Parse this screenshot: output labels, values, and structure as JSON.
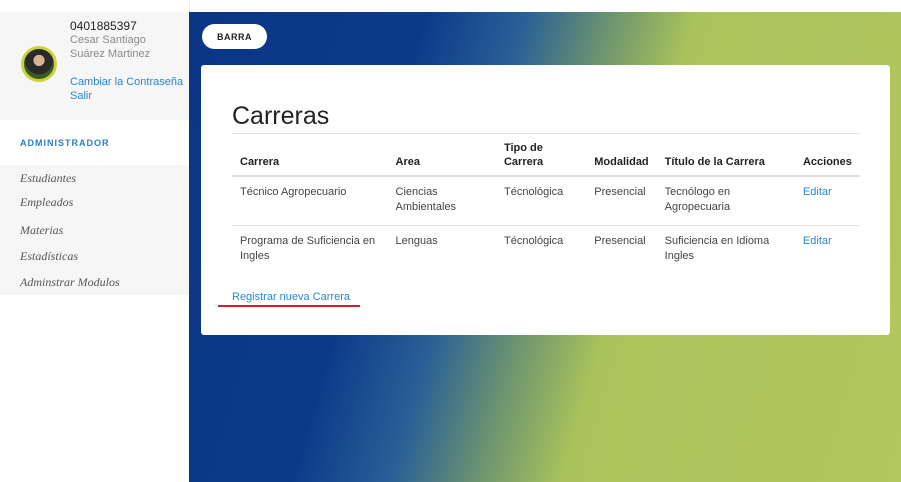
{
  "user": {
    "id": "0401885397",
    "name": "Cesar Santiago Suárez Martinez",
    "change_password": "Cambiar la Contraseña",
    "logout": "Salir"
  },
  "sidebar": {
    "role_title": "ADMINISTRADOR",
    "items": [
      {
        "label": "Estudiantes"
      },
      {
        "label": "Empleados"
      },
      {
        "label": "Materias"
      },
      {
        "label": "Estadísticas"
      },
      {
        "label": "Adminstrar Modulos"
      }
    ]
  },
  "header": {
    "barra_label": "BARRA"
  },
  "main": {
    "title": "Carreras",
    "columns": [
      "Carrera",
      "Area",
      "Tipo de Carrera",
      "Modalidad",
      "Título de la Carrera",
      "Acciones"
    ],
    "rows": [
      {
        "carrera": "Técnico Agropecuario",
        "area": "Ciencias Ambientales",
        "tipo": "Técnológica",
        "modalidad": "Presencial",
        "titulo": "Tecnólogo en Agropecuaria",
        "accion": "Editar"
      },
      {
        "carrera": "Programa de Suficiencia en Ingles",
        "area": "Lenguas",
        "tipo": "Técnológica",
        "modalidad": "Presencial",
        "titulo": "Suficiencia en Idioma Ingles",
        "accion": "Editar"
      }
    ],
    "register_link": "Registrar nueva Carrera"
  },
  "colors": {
    "link": "#2a86d6",
    "gradient_blue": "#0b3688",
    "gradient_green": "#b4c65e",
    "annotation_red": "#e0162b"
  }
}
